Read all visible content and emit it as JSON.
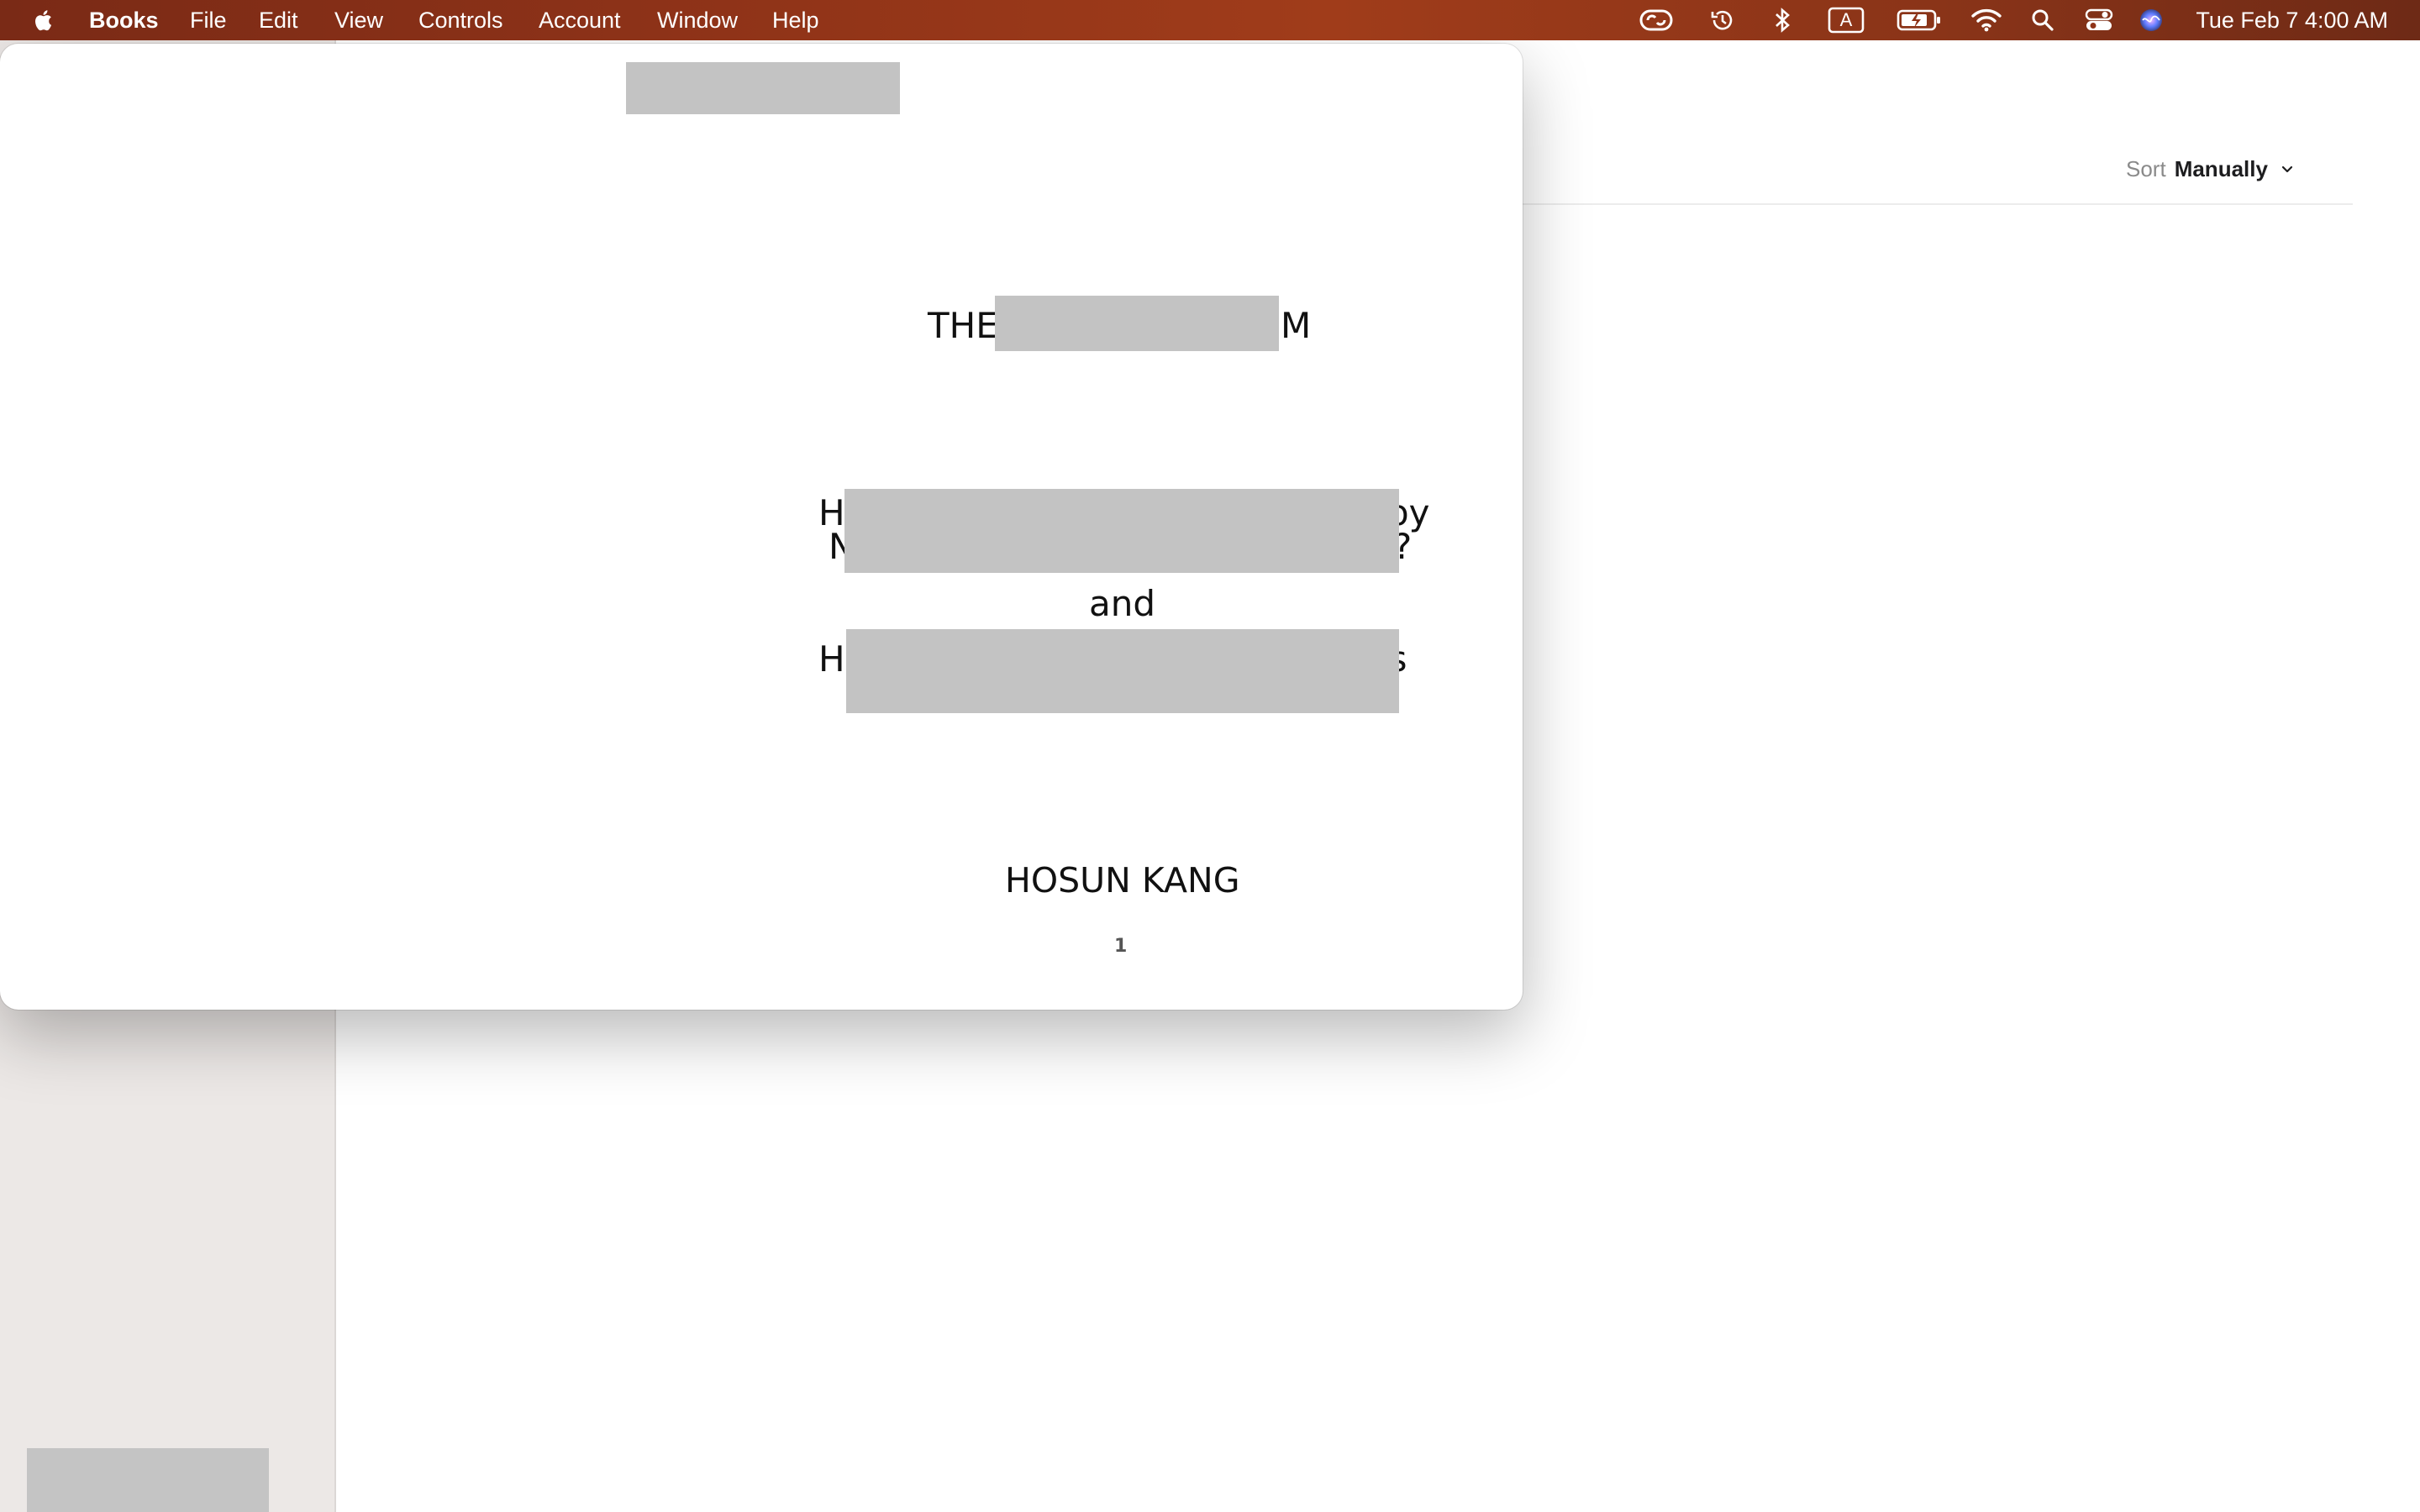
{
  "menubar": {
    "app_name": "Books",
    "items": [
      "File",
      "Edit",
      "View",
      "Controls",
      "Account",
      "Window",
      "Help"
    ],
    "clock": "Tue Feb 7  4:00 AM",
    "status_icons": [
      "creative-cloud-icon",
      "time-machine-icon",
      "bluetooth-icon",
      "input-source-icon",
      "battery-icon",
      "wifi-icon",
      "spotlight-icon",
      "control-center-icon",
      "siri-icon"
    ],
    "input_source_letter": "A"
  },
  "library": {
    "sort_label": "Sort",
    "sort_value": "Manually"
  },
  "book": {
    "title_start": "THE",
    "title_end": "M",
    "line1_start": "H",
    "line1_end": "by",
    "line2_start": "N",
    "line2_end": "?",
    "conjunction": "and",
    "line3_start": "H",
    "line3_end": "ns",
    "author": "HOSUN KANG",
    "page_number": "1"
  },
  "colors": {
    "menubar_accent": "#8f3318",
    "sidebar_bg": "#ece8e6",
    "redaction": "#c3c3c3"
  }
}
